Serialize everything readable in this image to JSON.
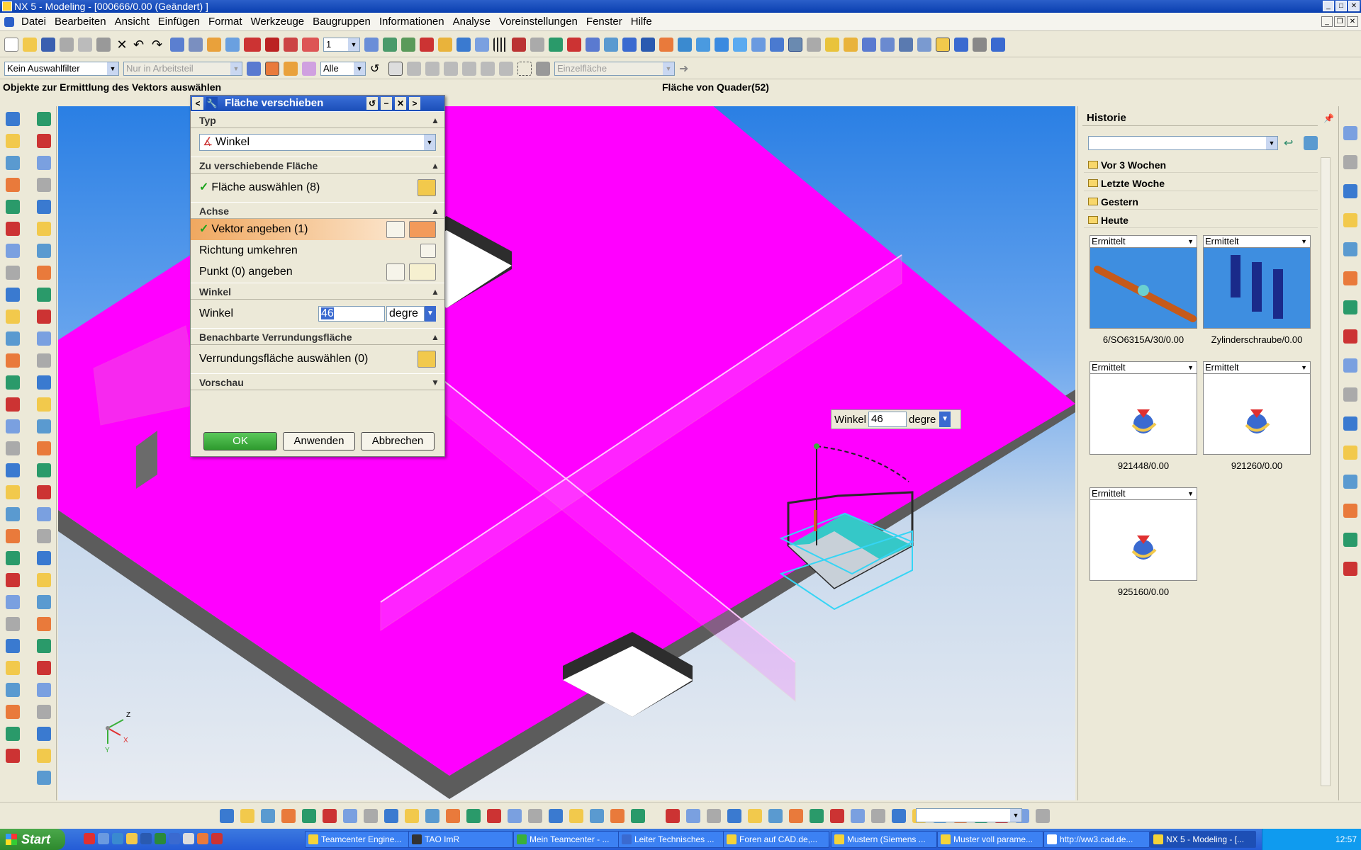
{
  "window": {
    "title": "NX 5 - Modeling - [000666/0.00 (Geändert) ]"
  },
  "menu": [
    "Datei",
    "Bearbeiten",
    "Ansicht",
    "Einfügen",
    "Format",
    "Werkzeuge",
    "Baugruppen",
    "Informationen",
    "Analyse",
    "Voreinstellungen",
    "Fenster",
    "Hilfe"
  ],
  "filterbar": {
    "selection_filter": "Kein Auswahlfilter",
    "workpart": "Nur in Arbeitsteil",
    "scope": "Alle",
    "face_rule": "Einzelfläche",
    "layer": "1"
  },
  "status": {
    "prompt": "Objekte zur Ermittlung des Vektors auswählen",
    "selected": "Fläche von Quader(52)"
  },
  "dialog": {
    "title": "Fläche verschieben",
    "typ_header": "Typ",
    "typ_value": "Winkel",
    "face_header": "Zu verschiebende Fläche",
    "face_select": "Fläche auswählen (8)",
    "axis_header": "Achse",
    "vector": "Vektor angeben (1)",
    "reverse": "Richtung umkehren",
    "point": "Punkt (0) angeben",
    "angle_header": "Winkel",
    "angle_label": "Winkel",
    "angle_value": "46",
    "angle_unit": "degre",
    "blend_header": "Benachbarte Verrundungsfläche",
    "blend_select": "Verrundungsfläche auswählen (0)",
    "preview_header": "Vorschau",
    "ok": "OK",
    "apply": "Anwenden",
    "cancel": "Abbrechen"
  },
  "floating_input": {
    "label": "Winkel",
    "value": "46",
    "unit": "degre"
  },
  "triad": {
    "x": "X",
    "y": "Y",
    "z": "Z"
  },
  "history": {
    "title": "Historie",
    "groups": [
      "Vor 3 Wochen",
      "Letzte Woche",
      "Gestern",
      "Heute"
    ],
    "cards": [
      {
        "status": "Ermittelt",
        "name": "6/SO6315A/30/0.00"
      },
      {
        "status": "Ermittelt",
        "name": "Zylinderschraube/0.00"
      },
      {
        "status": "Ermittelt",
        "name": "921448/0.00"
      },
      {
        "status": "Ermittelt",
        "name": "921260/0.00"
      },
      {
        "status": "Ermittelt",
        "name": "925160/0.00"
      }
    ]
  },
  "taskbar": {
    "start": "Start",
    "tasks": [
      "Teamcenter Engine...",
      "TAO ImR",
      "Mein Teamcenter - ...",
      "Leiter Technisches ...",
      "Foren auf CAD.de,...",
      "Mustern (Siemens ...",
      "Muster voll parame...",
      "http://ww3.cad.de...",
      "NX 5 - Modeling - [..."
    ],
    "clock": "12:57"
  },
  "colors": {
    "face": "#ff00ff",
    "accent": "#2b5fc9",
    "highlight": "#35c8c8"
  }
}
